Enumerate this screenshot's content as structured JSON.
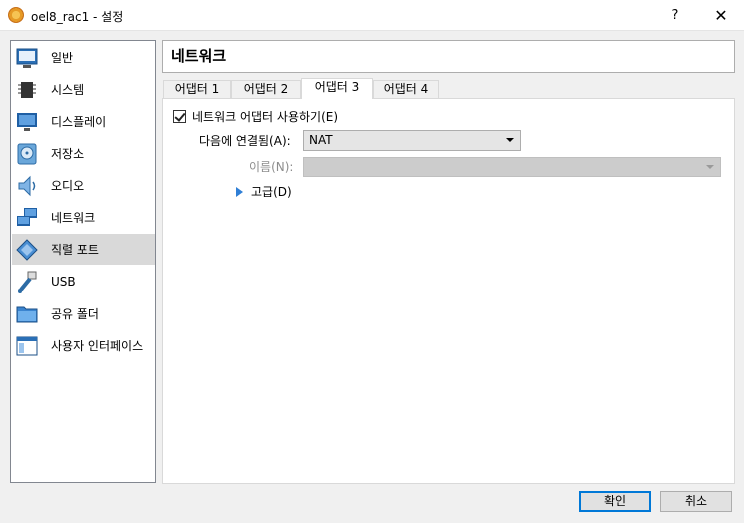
{
  "window": {
    "title": "oel8_rac1 - 설정",
    "help_label": "?",
    "close_label": "✕"
  },
  "sidebar": {
    "items": [
      {
        "label": "일반",
        "icon": "general-icon"
      },
      {
        "label": "시스템",
        "icon": "chip-icon"
      },
      {
        "label": "디스플레이",
        "icon": "monitor-icon"
      },
      {
        "label": "저장소",
        "icon": "disk-icon"
      },
      {
        "label": "오디오",
        "icon": "speaker-icon"
      },
      {
        "label": "네트워크",
        "icon": "network-icon"
      },
      {
        "label": "직렬 포트",
        "icon": "serial-port-icon"
      },
      {
        "label": "USB",
        "icon": "usb-icon"
      },
      {
        "label": "공유 폴더",
        "icon": "folder-icon"
      },
      {
        "label": "사용자 인터페이스",
        "icon": "ui-icon"
      }
    ],
    "selected_index": 6
  },
  "main": {
    "title": "네트워크",
    "tabs": [
      {
        "label": "어댑터 1"
      },
      {
        "label": "어댑터 2"
      },
      {
        "label": "어댑터 3"
      },
      {
        "label": "어댑터 4"
      }
    ],
    "active_tab": 2,
    "enable_adapter_label": "네트워크 어댑터 사용하기(E)",
    "enable_adapter_checked": true,
    "attached_to_label": "다음에 연결됨(A):",
    "attached_to_value": "NAT",
    "name_label": "이름(N):",
    "name_value": "",
    "advanced_label": "고급(D)"
  },
  "buttons": {
    "ok": "확인",
    "cancel": "취소"
  },
  "colors": {
    "selection": "#d9d9d9",
    "accent": "#0078d7",
    "advanced_arrow": "#2f7fd6"
  }
}
